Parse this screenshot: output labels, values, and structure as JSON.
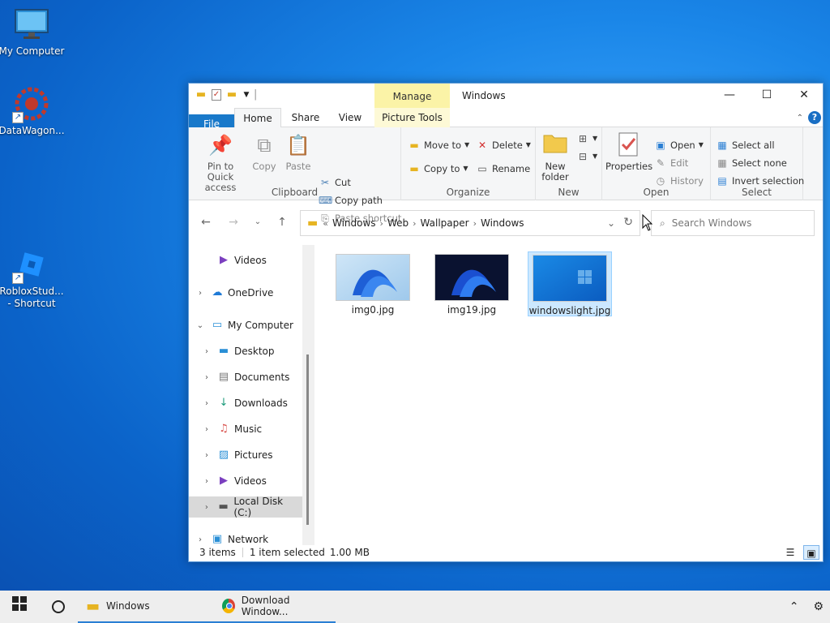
{
  "desktop": {
    "icons": [
      {
        "label": "My Computer",
        "icon": "monitor-icon"
      },
      {
        "label": "DataWagon...",
        "icon": "datawagon-icon"
      },
      {
        "label": "RobloxStud...",
        "label2": "- Shortcut",
        "icon": "roblox-studio-icon"
      }
    ]
  },
  "window": {
    "title": "Windows",
    "manage_tab": "Manage",
    "tabs": [
      "File",
      "Home",
      "Share",
      "View",
      "Picture Tools"
    ],
    "ribbon": {
      "clipboard": {
        "label": "Clipboard",
        "pin": "Pin to Quick access",
        "copy": "Copy",
        "paste": "Paste",
        "cut": "Cut",
        "copy_path": "Copy path",
        "paste_shortcut": "Paste shortcut"
      },
      "organize": {
        "label": "Organize",
        "move_to": "Move to",
        "copy_to": "Copy to",
        "delete": "Delete",
        "rename": "Rename"
      },
      "new": {
        "label": "New",
        "new_folder": "New folder"
      },
      "open": {
        "label": "Open",
        "properties": "Properties",
        "open": "Open",
        "edit": "Edit",
        "history": "History"
      },
      "select": {
        "label": "Select",
        "select_all": "Select all",
        "select_none": "Select none",
        "invert": "Invert selection"
      }
    },
    "address": {
      "prefix": "«",
      "segments": [
        "Windows",
        "Web",
        "Wallpaper",
        "Windows"
      ]
    },
    "search_placeholder": "Search Windows",
    "nav": [
      {
        "label": "Videos",
        "icon": "videos-icon"
      },
      {
        "label": "OneDrive",
        "icon": "onedrive-icon"
      },
      {
        "label": "My Computer",
        "icon": "computer-icon"
      },
      {
        "label": "Desktop",
        "icon": "desktop-icon"
      },
      {
        "label": "Documents",
        "icon": "documents-icon"
      },
      {
        "label": "Downloads",
        "icon": "downloads-icon"
      },
      {
        "label": "Music",
        "icon": "music-icon"
      },
      {
        "label": "Pictures",
        "icon": "pictures-icon"
      },
      {
        "label": "Videos",
        "icon": "videos-icon"
      },
      {
        "label": "Local Disk (C:)",
        "icon": "disk-icon"
      },
      {
        "label": "Network",
        "icon": "network-icon"
      }
    ],
    "files": [
      {
        "name": "img0.jpg",
        "selected": false
      },
      {
        "name": "img19.jpg",
        "selected": false
      },
      {
        "name": "windowslight.jpg",
        "selected": true
      }
    ],
    "status": {
      "items": "3 items",
      "selected": "1 item selected",
      "size": "1.00 MB"
    }
  },
  "taskbar": {
    "apps": [
      {
        "label": "Windows",
        "icon": "folder-icon"
      },
      {
        "label": "Download Window...",
        "icon": "chrome-icon"
      }
    ]
  },
  "colors": {
    "accent": "#1979ca",
    "manage_tab": "#fbf3a7",
    "selection": "#cce8ff"
  }
}
